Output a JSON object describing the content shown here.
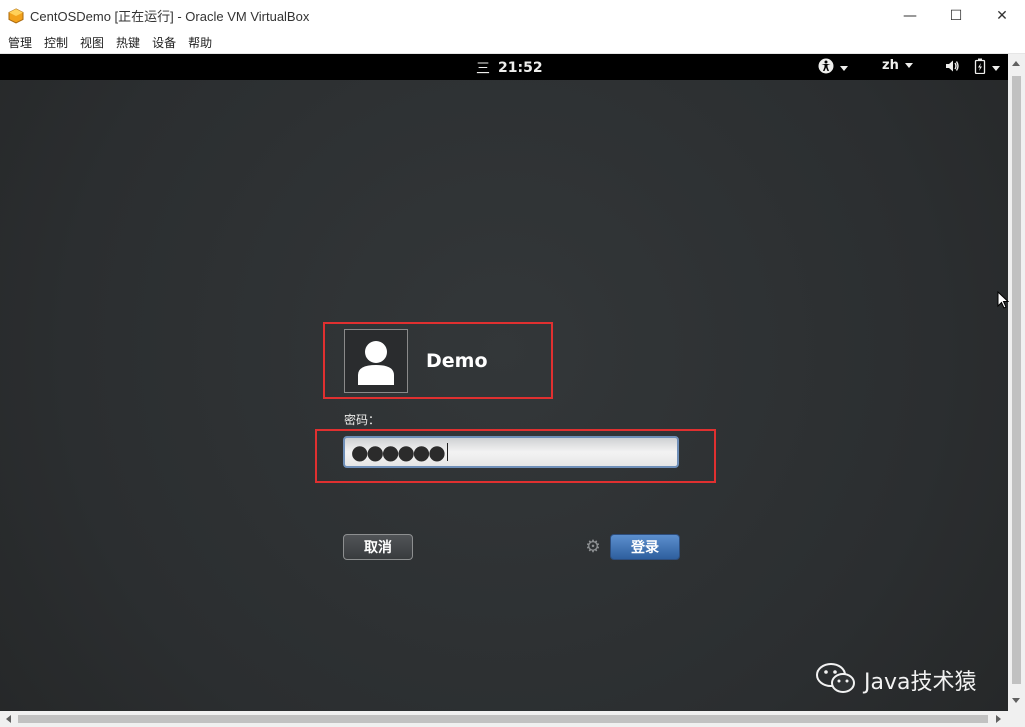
{
  "window": {
    "title": "CentOSDemo [正在运行] - Oracle VM VirtualBox",
    "app_icon": "virtualbox-icon",
    "controls": {
      "minimize": "—",
      "maximize": "☐",
      "close": "✕"
    }
  },
  "menu": [
    "管理",
    "控制",
    "视图",
    "热键",
    "设备",
    "帮助"
  ],
  "gnome_bar": {
    "activities_glyph": "三",
    "clock": "21:52",
    "language": "zh",
    "icons": [
      "accessibility-icon",
      "volume-icon",
      "battery-icon"
    ]
  },
  "login": {
    "username": "Demo",
    "password_label": "密码：",
    "password_mask": "●●●●●●",
    "cancel_label": "取消",
    "login_label": "登录"
  },
  "watermark": {
    "text": "Java技术猿",
    "icon": "wechat-icon"
  },
  "colors": {
    "highlight_box": "#e03030",
    "login_button": "#3d6fb0",
    "vm_background": "#2f3234"
  }
}
